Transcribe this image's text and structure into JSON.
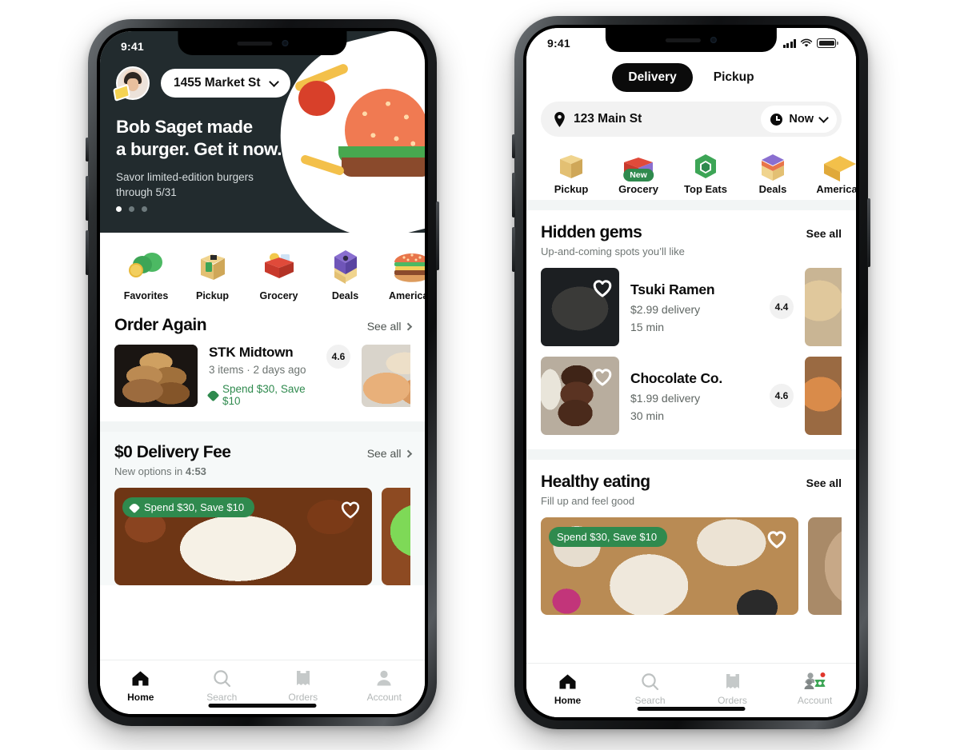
{
  "left_phone": {
    "status_bar": {
      "time": "9:41",
      "signal_icon": "cellular-bars-icon",
      "wifi_icon": "wifi-icon",
      "battery_icon": "battery-icon"
    },
    "header": {
      "avatar_name": "profile-avatar",
      "address": "1455 Market St",
      "chevron_icon": "chevron-down-icon"
    },
    "hero": {
      "title_line1": "Bob Saget made",
      "title_line2": "a burger. Get it now.",
      "subtitle_line1": "Savor limited-edition burgers",
      "subtitle_line2": "through 5/31",
      "dots_total": 3,
      "dots_active": 1,
      "bg_color": "#222b2e"
    },
    "categories": [
      {
        "label": "Favorites",
        "icon": "favorites-icon"
      },
      {
        "label": "Pickup",
        "icon": "pickup-bag-icon"
      },
      {
        "label": "Grocery",
        "icon": "grocery-basket-icon"
      },
      {
        "label": "Deals",
        "icon": "deals-store-icon"
      },
      {
        "label": "American",
        "icon": "american-burger-icon"
      }
    ],
    "order_again": {
      "title": "Order Again",
      "see_all": "See all",
      "cards": [
        {
          "name": "STK Midtown",
          "meta": "3 items · 2 days ago",
          "promo": "Spend $30, Save $10",
          "rating": "4.6"
        }
      ]
    },
    "delivery_fee": {
      "title": "$0 Delivery Fee",
      "subtitle_prefix": "New options in ",
      "subtitle_timer": "4:53",
      "see_all": "See all",
      "card_promo": "Spend $30, Save $10",
      "heart_icon": "heart-outline-icon"
    },
    "tabbar": [
      {
        "label": "Home",
        "icon": "home-icon",
        "active": true
      },
      {
        "label": "Search",
        "icon": "search-icon",
        "active": false
      },
      {
        "label": "Orders",
        "icon": "orders-receipt-icon",
        "active": false
      },
      {
        "label": "Account",
        "icon": "account-person-icon",
        "active": false
      }
    ]
  },
  "right_phone": {
    "status_bar": {
      "time": "9:41",
      "signal_icon": "cellular-bars-icon",
      "wifi_icon": "wifi-icon",
      "battery_icon": "battery-icon"
    },
    "segmented": {
      "options": [
        "Delivery",
        "Pickup"
      ],
      "selected": "Delivery"
    },
    "location_bar": {
      "pin_icon": "location-pin-icon",
      "address": "123 Main St",
      "time_label": "Now",
      "clock_icon": "clock-icon",
      "chevron_icon": "chevron-down-icon"
    },
    "categories": [
      {
        "label": "Pickup",
        "icon": "pickup-bag-icon",
        "badge": ""
      },
      {
        "label": "Grocery",
        "icon": "grocery-basket-icon",
        "badge": "New"
      },
      {
        "label": "Top Eats",
        "icon": "top-eats-icon",
        "badge": ""
      },
      {
        "label": "Deals",
        "icon": "deals-store-icon",
        "badge": ""
      },
      {
        "label": "American",
        "icon": "american-burger-icon",
        "badge": ""
      }
    ],
    "hidden_gems": {
      "title": "Hidden gems",
      "subtitle": "Up-and-coming spots you’ll like",
      "see_all": "See all",
      "items": [
        {
          "name": "Tsuki Ramen",
          "delivery": "$2.99 delivery",
          "time": "15 min",
          "rating": "4.4",
          "heart_icon": "heart-outline-icon"
        },
        {
          "name": "Chocolate Co.",
          "delivery": "$1.99 delivery",
          "time": "30 min",
          "rating": "4.6",
          "heart_icon": "heart-outline-icon"
        }
      ]
    },
    "healthy_eating": {
      "title": "Healthy eating",
      "subtitle": "Fill up and feel good",
      "see_all": "See all",
      "card_promo": "Spend $30, Save $10",
      "heart_icon": "heart-outline-icon"
    },
    "tabbar": [
      {
        "label": "Home",
        "icon": "home-icon",
        "active": true
      },
      {
        "label": "Search",
        "icon": "search-icon",
        "active": false
      },
      {
        "label": "Orders",
        "icon": "orders-receipt-icon",
        "active": false
      },
      {
        "label": "Account",
        "icon": "account-people-green-icon",
        "active": false
      }
    ]
  },
  "colors": {
    "dark_hero": "#222b2e",
    "promo_green": "#2f8a4e",
    "accent_black": "#0b0b0b",
    "muted_text": "#6d7471",
    "panel_gray": "#f6f9f9",
    "chip_gray": "#f2f2f2"
  }
}
